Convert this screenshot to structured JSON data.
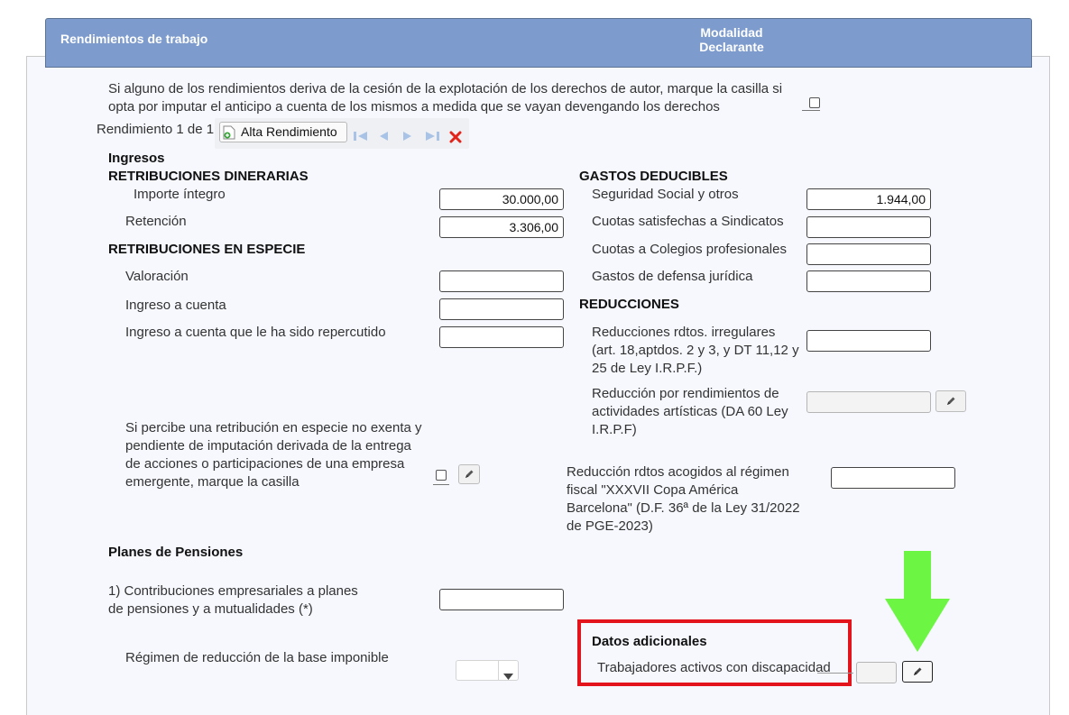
{
  "header": {
    "title": "Rendimientos de trabajo",
    "modalidad_line1": "Modalidad",
    "modalidad_line2": "Declarante"
  },
  "autor": {
    "line1": "Si alguno de los rendimientos deriva de la cesión de la explotación de los derechos de autor, marque la casilla si",
    "line2": "opta por imputar el anticipo a cuenta de los mismos a medida que se vayan devengando los derechos"
  },
  "nav": {
    "rendimiento_label": "Rendimiento 1 de 1",
    "alta_button": "Alta Rendimiento"
  },
  "left": {
    "ingresos": "Ingresos",
    "dinerarias": "RETRIBUCIONES DINERARIAS",
    "importe_label": "Importe íntegro",
    "importe_value": "30.000,00",
    "retencion_label": "Retención",
    "retencion_value": "3.306,00",
    "especie": "RETRIBUCIONES EN ESPECIE",
    "valoracion_label": "Valoración",
    "ingreso_cuenta_label": "Ingreso a cuenta",
    "ingreso_repercutido_label": "Ingreso a cuenta que le ha sido repercutido",
    "emergente_lines": [
      "Si percibe una retribución en especie no exenta y",
      "pendiente de imputación derivada de la entrega",
      "de acciones o participaciones de una empresa",
      "emergente, marque la casilla"
    ]
  },
  "right": {
    "gastos": "GASTOS DEDUCIBLES",
    "seguridad_label": "Seguridad Social y otros",
    "seguridad_value": "1.944,00",
    "sindicatos_label": "Cuotas satisfechas a Sindicatos",
    "colegios_label": "Cuotas a Colegios profesionales",
    "defensa_label": "Gastos de defensa jurídica",
    "reducciones": "REDUCCIONES",
    "irregulares_lines": [
      "Reducciones rdtos. irregulares",
      "(art. 18,aptdos. 2 y 3, y DT 11,12 y",
      "25 de Ley I.R.P.F.)"
    ],
    "artisticas_lines": [
      "Reducción por rendimientos de",
      "actividades artísticas (DA 60 Ley",
      "I.R.P.F)"
    ],
    "copa_lines": [
      "Reducción rdtos acogidos al régimen",
      "fiscal \"XXXVII Copa América",
      "Barcelona\" (D.F. 36ª de la Ley 31/2022",
      "de PGE-2023)"
    ]
  },
  "pensiones": {
    "title": "Planes de Pensiones",
    "contrib_lines": [
      "1) Contribuciones empresariales a planes",
      "de pensiones y a mutualidades (*)"
    ],
    "regimen_label": "Régimen de reducción de la base imponible"
  },
  "datos": {
    "title": "Datos adicionales",
    "discapacidad_label": "Trabajadores activos con discapacidad"
  },
  "colors": {
    "header_bg": "#7d9bcc",
    "highlight_red": "#e4141c",
    "arrow_green": "#6cf542"
  }
}
